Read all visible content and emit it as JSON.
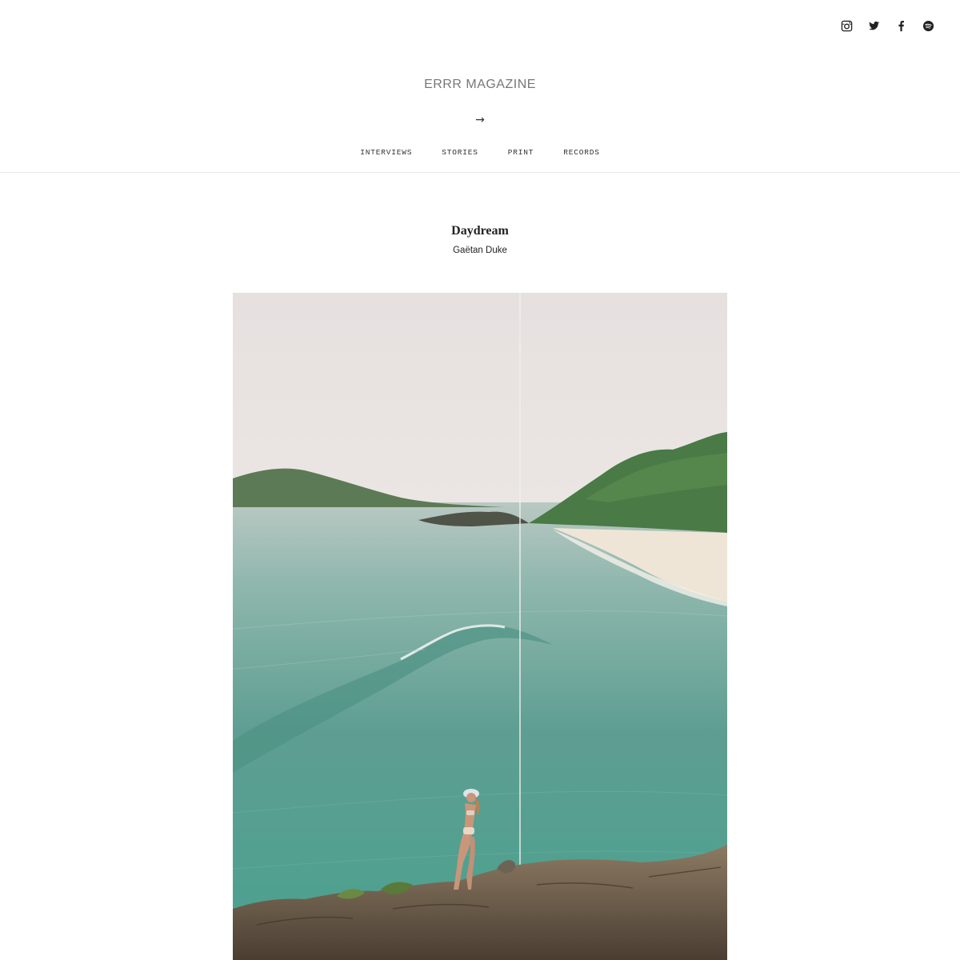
{
  "social": {
    "icons": [
      "instagram-icon",
      "twitter-icon",
      "facebook-icon",
      "spotify-icon"
    ]
  },
  "header": {
    "masthead": "ERRR MAGAZINE",
    "arrow": "→"
  },
  "nav": {
    "items": [
      {
        "label": "INTERVIEWS"
      },
      {
        "label": "STORIES"
      },
      {
        "label": "PRINT"
      },
      {
        "label": "RECORDS"
      }
    ]
  },
  "article": {
    "title": "Daydream",
    "author": "Gaëtan Duke"
  },
  "colors": {
    "sky": "#e7e1e0",
    "sea": "#5ea79b",
    "hill": "#4e7a4c",
    "sand": "#eee3d3",
    "rock": "#6b5a47"
  }
}
